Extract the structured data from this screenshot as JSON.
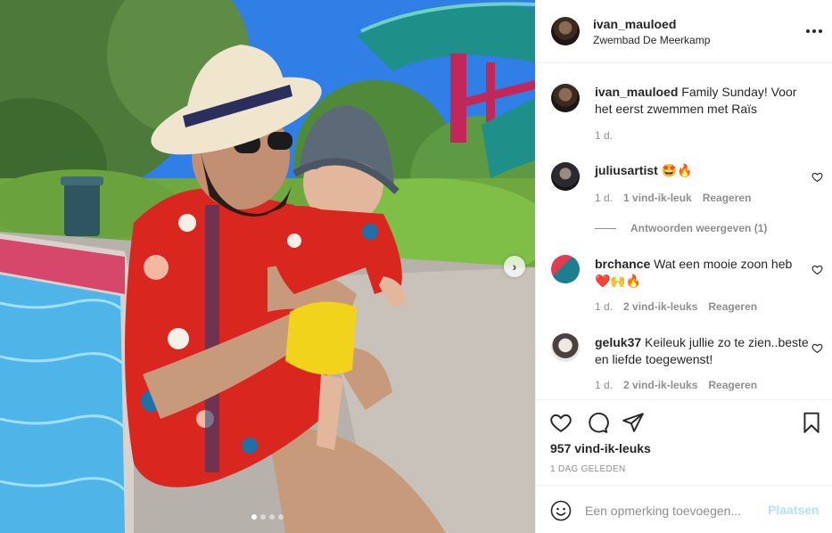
{
  "post": {
    "username": "ivan_mauloed",
    "location": "Zwembad De Meerkamp",
    "caption": "Family Sunday! Voor het eerst zwemmen met Raïs",
    "caption_age": "1 d.",
    "more_icon": "more-horizontal-icon",
    "carousel": {
      "slides": 4,
      "active": 1,
      "next_icon": "chevron-right-icon",
      "next_glyph": "›"
    }
  },
  "comments": [
    {
      "username": "juliusartist",
      "text": "🤩🔥",
      "age": "1 d.",
      "likes": "1 vind-ik-leuk",
      "reply": "Reageren",
      "view_replies": "Antwoorden weergeven (1)"
    },
    {
      "username": "brchance",
      "text": "Wat een mooie zoon heb ❤️🙌🔥",
      "age": "1 d.",
      "likes": "2 vind-ik-leuks",
      "reply": "Reageren"
    },
    {
      "username": "geluk37",
      "text": "Keileuk jullie zo te zien..beste en liefde toegewenst!",
      "age": "1 d.",
      "likes": "2 vind-ik-leuks",
      "reply": "Reageren"
    }
  ],
  "actions": {
    "like_icon": "heart-icon",
    "comment_icon": "comment-icon",
    "share_icon": "send-icon",
    "save_icon": "bookmark-icon",
    "likes_count": "957 vind-ik-leuks",
    "posted_ago": "1 DAG GELEDEN"
  },
  "composer": {
    "emoji_icon": "smiley-icon",
    "placeholder": "Een opmerking toevoegen...",
    "post_label": "Plaatsen"
  },
  "colors": {
    "text": "#262626",
    "secondary": "#8e8e8e",
    "border": "#efefef",
    "post_disabled": "#b2dffc"
  }
}
